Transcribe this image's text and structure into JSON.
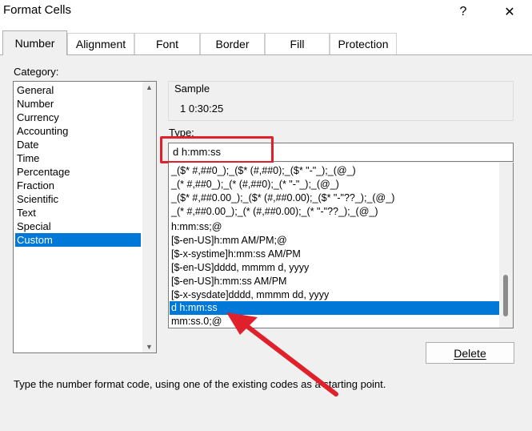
{
  "window": {
    "title": "Format Cells",
    "help_glyph": "?",
    "close_glyph": "✕"
  },
  "tabs": [
    "Number",
    "Alignment",
    "Font",
    "Border",
    "Fill",
    "Protection"
  ],
  "category": {
    "label": "Category:",
    "items": [
      "General",
      "Number",
      "Currency",
      "Accounting",
      "Date",
      "Time",
      "Percentage",
      "Fraction",
      "Scientific",
      "Text",
      "Special",
      "Custom"
    ],
    "selected": "Custom"
  },
  "sample": {
    "label": "Sample",
    "value": "1 0:30:25"
  },
  "type": {
    "label": "Type:",
    "value": "d h:mm:ss",
    "items": [
      "_($* #,##0_);_($* (#,##0);_($* \"-\"_);_(@_)",
      "_(* #,##0_);_(* (#,##0);_(* \"-\"_);_(@_)",
      "_($* #,##0.00_);_($* (#,##0.00);_($* \"-\"??_);_(@_)",
      "_(* #,##0.00_);_(* (#,##0.00);_(* \"-\"??_);_(@_)",
      "h:mm:ss;@",
      "[$-en-US]h:mm AM/PM;@",
      "[$-x-systime]h:mm:ss AM/PM",
      "[$-en-US]dddd, mmmm d, yyyy",
      "[$-en-US]h:mm:ss AM/PM",
      "[$-x-sysdate]dddd, mmmm dd, yyyy",
      "d h:mm:ss",
      "mm:ss.0;@"
    ],
    "selected": "d h:mm:ss"
  },
  "buttons": {
    "delete": "Delete"
  },
  "hint": "Type the number format code, using one of the existing codes as a starting point.",
  "annotation_color": "#e0202a",
  "selection_color": "#0078d7"
}
